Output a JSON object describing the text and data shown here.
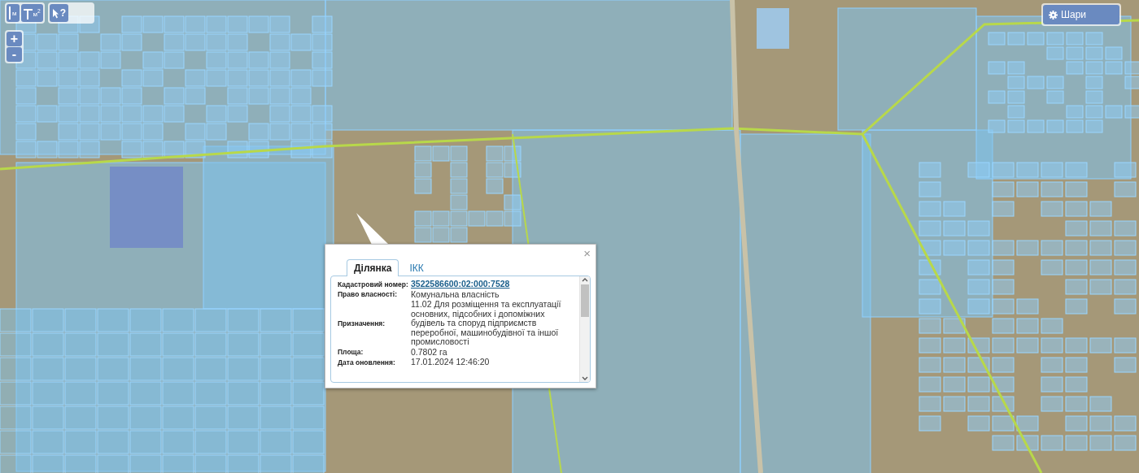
{
  "toolbar": {
    "tools": [
      {
        "kind": "line",
        "label": "м"
      },
      {
        "kind": "area",
        "label": "м$^{2}$"
      },
      {
        "kind": "query",
        "label": "?"
      }
    ]
  },
  "zoom": {
    "buttons": [
      "+",
      "-"
    ]
  },
  "layers_button": {
    "label": "Шари"
  },
  "popup": {
    "close": "×",
    "tabs": [
      {
        "label": "Ділянка",
        "selected": true
      },
      {
        "label": "ІКК",
        "selected": false
      }
    ],
    "rows": [
      {
        "kind": "link",
        "label": "Кадастровий номер:",
        "value": "3522586600:02:000:7528"
      },
      {
        "kind": "text",
        "label": "Право власності:",
        "value": "Комунальна власність"
      },
      {
        "kind": "text",
        "label": "Призначення:",
        "value": "11.02 Для розміщення та експлуатації основних, підсобних і допоміжних будівель та споруд підприємств переробної, машинобудівної та іншої промисловості"
      },
      {
        "kind": "text",
        "label": "Площа:",
        "value": "0.7802 га"
      },
      {
        "kind": "text",
        "label": "Дата оновлення:",
        "value": "17.01.2024 12:46:20"
      }
    ]
  }
}
